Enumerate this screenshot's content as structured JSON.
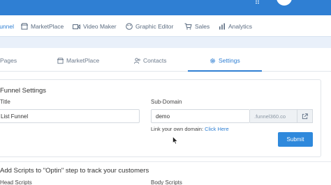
{
  "colors": {
    "primary": "#2f7fd3",
    "submit": "#2f89dc",
    "nav_text": "#5a6b80",
    "page_bg_strip": "#e9f0fa"
  },
  "topbar": {
    "apps_icon": "grid-icon",
    "avatar_icon": "user-avatar"
  },
  "main_nav": {
    "items": [
      {
        "label": "Funnel",
        "icon": "funnel-icon"
      },
      {
        "label": "MarketPlace",
        "icon": "store-icon"
      },
      {
        "label": "Video Maker",
        "icon": "video-icon"
      },
      {
        "label": "Graphic Editor",
        "icon": "palette-icon"
      },
      {
        "label": "Sales",
        "icon": "cart-icon"
      },
      {
        "label": "Analytics",
        "icon": "bar-chart-icon"
      }
    ]
  },
  "tabs": [
    {
      "label": "Pages",
      "icon": "pages-icon"
    },
    {
      "label": "MarketPlace",
      "icon": "store-icon"
    },
    {
      "label": "Contacts",
      "icon": "contacts-icon"
    },
    {
      "label": "Settings",
      "icon": "gear-icon",
      "active": true
    }
  ],
  "settings": {
    "section_title": "Funnel Settings",
    "title_label": "Title",
    "title_value": "List Funnel",
    "subdomain_label": "Sub-Domain",
    "subdomain_value": "demo",
    "subdomain_suffix": ".funnel360.co",
    "domain_help_text": "Link your own domain:",
    "domain_help_link": "Click Here",
    "submit_label": "Submit"
  },
  "scripts": {
    "title": "Add Scripts to \"Optin\" step to track your customers",
    "head_label": "Head Scripts",
    "body_label": "Body Scripts"
  }
}
